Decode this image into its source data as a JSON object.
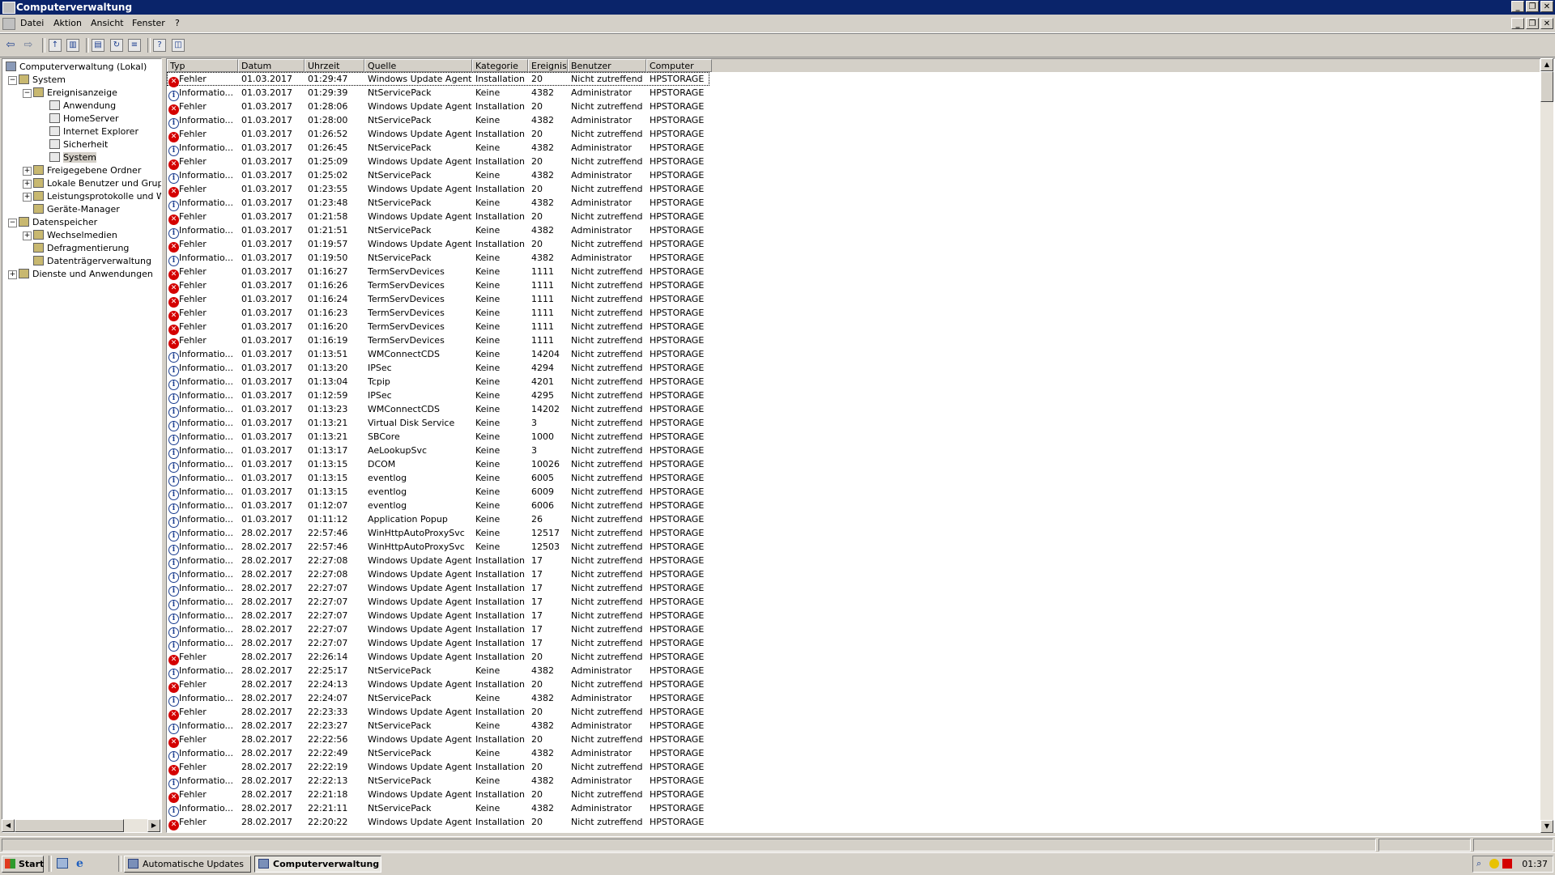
{
  "window": {
    "title": "Computerverwaltung"
  },
  "menu": [
    "Datei",
    "Aktion",
    "Ansicht",
    "Fenster",
    "?"
  ],
  "toolbar_icons": [
    "back-icon",
    "forward-icon",
    "up-folder-icon",
    "show-tree-icon",
    "properties-icon",
    "refresh-icon",
    "export-list-icon",
    "help-icon",
    "details-view-icon"
  ],
  "tree": [
    {
      "label": "Computerverwaltung (Lokal)",
      "level": 0
    },
    {
      "label": "System",
      "level": 1,
      "expander": "−"
    },
    {
      "label": "Ereignisanzeige",
      "level": 2,
      "expander": "−"
    },
    {
      "label": "Anwendung",
      "level": 3
    },
    {
      "label": "HomeServer",
      "level": 3
    },
    {
      "label": "Internet Explorer",
      "level": 3
    },
    {
      "label": "Sicherheit",
      "level": 3
    },
    {
      "label": "System",
      "level": 3,
      "selected": true
    },
    {
      "label": "Freigegebene Ordner",
      "level": 2,
      "expander": "+"
    },
    {
      "label": "Lokale Benutzer und Gruppe",
      "level": 2,
      "expander": "+"
    },
    {
      "label": "Leistungsprotokolle und War",
      "level": 2,
      "expander": "+"
    },
    {
      "label": "Geräte-Manager",
      "level": 2
    },
    {
      "label": "Datenspeicher",
      "level": 1,
      "expander": "−"
    },
    {
      "label": "Wechselmedien",
      "level": 2,
      "expander": "+"
    },
    {
      "label": "Defragmentierung",
      "level": 2
    },
    {
      "label": "Datenträgerverwaltung",
      "level": 2
    },
    {
      "label": "Dienste und Anwendungen",
      "level": 1,
      "expander": "+"
    }
  ],
  "columns": [
    "Typ",
    "Datum",
    "Uhrzeit",
    "Quelle",
    "Kategorie",
    "Ereignis",
    "Benutzer",
    "Computer"
  ],
  "rows": [
    [
      "Fehler",
      "01.03.2017",
      "01:29:47",
      "Windows Update Agent",
      "Installation",
      "20",
      "Nicht zutreffend",
      "HPSTORAGE"
    ],
    [
      "Informatio...",
      "01.03.2017",
      "01:29:39",
      "NtServicePack",
      "Keine",
      "4382",
      "Administrator",
      "HPSTORAGE"
    ],
    [
      "Fehler",
      "01.03.2017",
      "01:28:06",
      "Windows Update Agent",
      "Installation",
      "20",
      "Nicht zutreffend",
      "HPSTORAGE"
    ],
    [
      "Informatio...",
      "01.03.2017",
      "01:28:00",
      "NtServicePack",
      "Keine",
      "4382",
      "Administrator",
      "HPSTORAGE"
    ],
    [
      "Fehler",
      "01.03.2017",
      "01:26:52",
      "Windows Update Agent",
      "Installation",
      "20",
      "Nicht zutreffend",
      "HPSTORAGE"
    ],
    [
      "Informatio...",
      "01.03.2017",
      "01:26:45",
      "NtServicePack",
      "Keine",
      "4382",
      "Administrator",
      "HPSTORAGE"
    ],
    [
      "Fehler",
      "01.03.2017",
      "01:25:09",
      "Windows Update Agent",
      "Installation",
      "20",
      "Nicht zutreffend",
      "HPSTORAGE"
    ],
    [
      "Informatio...",
      "01.03.2017",
      "01:25:02",
      "NtServicePack",
      "Keine",
      "4382",
      "Administrator",
      "HPSTORAGE"
    ],
    [
      "Fehler",
      "01.03.2017",
      "01:23:55",
      "Windows Update Agent",
      "Installation",
      "20",
      "Nicht zutreffend",
      "HPSTORAGE"
    ],
    [
      "Informatio...",
      "01.03.2017",
      "01:23:48",
      "NtServicePack",
      "Keine",
      "4382",
      "Administrator",
      "HPSTORAGE"
    ],
    [
      "Fehler",
      "01.03.2017",
      "01:21:58",
      "Windows Update Agent",
      "Installation",
      "20",
      "Nicht zutreffend",
      "HPSTORAGE"
    ],
    [
      "Informatio...",
      "01.03.2017",
      "01:21:51",
      "NtServicePack",
      "Keine",
      "4382",
      "Administrator",
      "HPSTORAGE"
    ],
    [
      "Fehler",
      "01.03.2017",
      "01:19:57",
      "Windows Update Agent",
      "Installation",
      "20",
      "Nicht zutreffend",
      "HPSTORAGE"
    ],
    [
      "Informatio...",
      "01.03.2017",
      "01:19:50",
      "NtServicePack",
      "Keine",
      "4382",
      "Administrator",
      "HPSTORAGE"
    ],
    [
      "Fehler",
      "01.03.2017",
      "01:16:27",
      "TermServDevices",
      "Keine",
      "1111",
      "Nicht zutreffend",
      "HPSTORAGE"
    ],
    [
      "Fehler",
      "01.03.2017",
      "01:16:26",
      "TermServDevices",
      "Keine",
      "1111",
      "Nicht zutreffend",
      "HPSTORAGE"
    ],
    [
      "Fehler",
      "01.03.2017",
      "01:16:24",
      "TermServDevices",
      "Keine",
      "1111",
      "Nicht zutreffend",
      "HPSTORAGE"
    ],
    [
      "Fehler",
      "01.03.2017",
      "01:16:23",
      "TermServDevices",
      "Keine",
      "1111",
      "Nicht zutreffend",
      "HPSTORAGE"
    ],
    [
      "Fehler",
      "01.03.2017",
      "01:16:20",
      "TermServDevices",
      "Keine",
      "1111",
      "Nicht zutreffend",
      "HPSTORAGE"
    ],
    [
      "Fehler",
      "01.03.2017",
      "01:16:19",
      "TermServDevices",
      "Keine",
      "1111",
      "Nicht zutreffend",
      "HPSTORAGE"
    ],
    [
      "Informatio...",
      "01.03.2017",
      "01:13:51",
      "WMConnectCDS",
      "Keine",
      "14204",
      "Nicht zutreffend",
      "HPSTORAGE"
    ],
    [
      "Informatio...",
      "01.03.2017",
      "01:13:20",
      "IPSec",
      "Keine",
      "4294",
      "Nicht zutreffend",
      "HPSTORAGE"
    ],
    [
      "Informatio...",
      "01.03.2017",
      "01:13:04",
      "Tcpip",
      "Keine",
      "4201",
      "Nicht zutreffend",
      "HPSTORAGE"
    ],
    [
      "Informatio...",
      "01.03.2017",
      "01:12:59",
      "IPSec",
      "Keine",
      "4295",
      "Nicht zutreffend",
      "HPSTORAGE"
    ],
    [
      "Informatio...",
      "01.03.2017",
      "01:13:23",
      "WMConnectCDS",
      "Keine",
      "14202",
      "Nicht zutreffend",
      "HPSTORAGE"
    ],
    [
      "Informatio...",
      "01.03.2017",
      "01:13:21",
      "Virtual Disk Service",
      "Keine",
      "3",
      "Nicht zutreffend",
      "HPSTORAGE"
    ],
    [
      "Informatio...",
      "01.03.2017",
      "01:13:21",
      "SBCore",
      "Keine",
      "1000",
      "Nicht zutreffend",
      "HPSTORAGE"
    ],
    [
      "Informatio...",
      "01.03.2017",
      "01:13:17",
      "AeLookupSvc",
      "Keine",
      "3",
      "Nicht zutreffend",
      "HPSTORAGE"
    ],
    [
      "Informatio...",
      "01.03.2017",
      "01:13:15",
      "DCOM",
      "Keine",
      "10026",
      "Nicht zutreffend",
      "HPSTORAGE"
    ],
    [
      "Informatio...",
      "01.03.2017",
      "01:13:15",
      "eventlog",
      "Keine",
      "6005",
      "Nicht zutreffend",
      "HPSTORAGE"
    ],
    [
      "Informatio...",
      "01.03.2017",
      "01:13:15",
      "eventlog",
      "Keine",
      "6009",
      "Nicht zutreffend",
      "HPSTORAGE"
    ],
    [
      "Informatio...",
      "01.03.2017",
      "01:12:07",
      "eventlog",
      "Keine",
      "6006",
      "Nicht zutreffend",
      "HPSTORAGE"
    ],
    [
      "Informatio...",
      "01.03.2017",
      "01:11:12",
      "Application Popup",
      "Keine",
      "26",
      "Nicht zutreffend",
      "HPSTORAGE"
    ],
    [
      "Informatio...",
      "28.02.2017",
      "22:57:46",
      "WinHttpAutoProxySvc",
      "Keine",
      "12517",
      "Nicht zutreffend",
      "HPSTORAGE"
    ],
    [
      "Informatio...",
      "28.02.2017",
      "22:57:46",
      "WinHttpAutoProxySvc",
      "Keine",
      "12503",
      "Nicht zutreffend",
      "HPSTORAGE"
    ],
    [
      "Informatio...",
      "28.02.2017",
      "22:27:08",
      "Windows Update Agent",
      "Installation",
      "17",
      "Nicht zutreffend",
      "HPSTORAGE"
    ],
    [
      "Informatio...",
      "28.02.2017",
      "22:27:08",
      "Windows Update Agent",
      "Installation",
      "17",
      "Nicht zutreffend",
      "HPSTORAGE"
    ],
    [
      "Informatio...",
      "28.02.2017",
      "22:27:07",
      "Windows Update Agent",
      "Installation",
      "17",
      "Nicht zutreffend",
      "HPSTORAGE"
    ],
    [
      "Informatio...",
      "28.02.2017",
      "22:27:07",
      "Windows Update Agent",
      "Installation",
      "17",
      "Nicht zutreffend",
      "HPSTORAGE"
    ],
    [
      "Informatio...",
      "28.02.2017",
      "22:27:07",
      "Windows Update Agent",
      "Installation",
      "17",
      "Nicht zutreffend",
      "HPSTORAGE"
    ],
    [
      "Informatio...",
      "28.02.2017",
      "22:27:07",
      "Windows Update Agent",
      "Installation",
      "17",
      "Nicht zutreffend",
      "HPSTORAGE"
    ],
    [
      "Informatio...",
      "28.02.2017",
      "22:27:07",
      "Windows Update Agent",
      "Installation",
      "17",
      "Nicht zutreffend",
      "HPSTORAGE"
    ],
    [
      "Fehler",
      "28.02.2017",
      "22:26:14",
      "Windows Update Agent",
      "Installation",
      "20",
      "Nicht zutreffend",
      "HPSTORAGE"
    ],
    [
      "Informatio...",
      "28.02.2017",
      "22:25:17",
      "NtServicePack",
      "Keine",
      "4382",
      "Administrator",
      "HPSTORAGE"
    ],
    [
      "Fehler",
      "28.02.2017",
      "22:24:13",
      "Windows Update Agent",
      "Installation",
      "20",
      "Nicht zutreffend",
      "HPSTORAGE"
    ],
    [
      "Informatio...",
      "28.02.2017",
      "22:24:07",
      "NtServicePack",
      "Keine",
      "4382",
      "Administrator",
      "HPSTORAGE"
    ],
    [
      "Fehler",
      "28.02.2017",
      "22:23:33",
      "Windows Update Agent",
      "Installation",
      "20",
      "Nicht zutreffend",
      "HPSTORAGE"
    ],
    [
      "Informatio...",
      "28.02.2017",
      "22:23:27",
      "NtServicePack",
      "Keine",
      "4382",
      "Administrator",
      "HPSTORAGE"
    ],
    [
      "Fehler",
      "28.02.2017",
      "22:22:56",
      "Windows Update Agent",
      "Installation",
      "20",
      "Nicht zutreffend",
      "HPSTORAGE"
    ],
    [
      "Informatio...",
      "28.02.2017",
      "22:22:49",
      "NtServicePack",
      "Keine",
      "4382",
      "Administrator",
      "HPSTORAGE"
    ],
    [
      "Fehler",
      "28.02.2017",
      "22:22:19",
      "Windows Update Agent",
      "Installation",
      "20",
      "Nicht zutreffend",
      "HPSTORAGE"
    ],
    [
      "Informatio...",
      "28.02.2017",
      "22:22:13",
      "NtServicePack",
      "Keine",
      "4382",
      "Administrator",
      "HPSTORAGE"
    ],
    [
      "Fehler",
      "28.02.2017",
      "22:21:18",
      "Windows Update Agent",
      "Installation",
      "20",
      "Nicht zutreffend",
      "HPSTORAGE"
    ],
    [
      "Informatio...",
      "28.02.2017",
      "22:21:11",
      "NtServicePack",
      "Keine",
      "4382",
      "Administrator",
      "HPSTORAGE"
    ],
    [
      "Fehler",
      "28.02.2017",
      "22:20:22",
      "Windows Update Agent",
      "Installation",
      "20",
      "Nicht zutreffend",
      "HPSTORAGE"
    ]
  ],
  "taskbar": {
    "start": "Start",
    "quicklaunch_icons": [
      "desktop-icon",
      "internet-explorer-icon"
    ],
    "buttons": [
      {
        "label": "Automatische Updates",
        "active": false
      },
      {
        "label": "Computerverwaltung",
        "active": true
      }
    ],
    "clock": "01:37"
  },
  "colors": {
    "titlebar": "#0a246a",
    "error": "#d40000",
    "info": "#1a3d8f",
    "face": "#d4d0c8"
  }
}
